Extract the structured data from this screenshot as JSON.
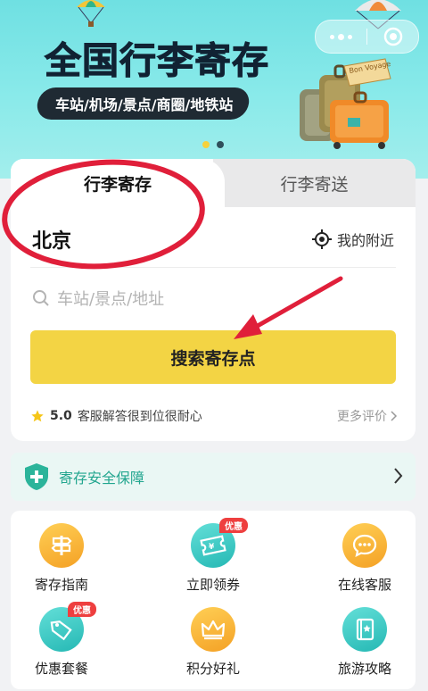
{
  "banner": {
    "title": "全国行李寄存",
    "subtitle": "车站/机场/景点/商圈/地铁站",
    "luggage_sticker": "Bon Voyage",
    "carousel_active_index": 0,
    "carousel_count": 2
  },
  "capsule": {
    "more_icon": "more-dots-icon",
    "close_icon": "close-target-icon"
  },
  "tabs": {
    "storage": "行李寄存",
    "delivery": "行李寄送"
  },
  "location": {
    "city": "北京",
    "nearby_label": "我的附近"
  },
  "search": {
    "placeholder": "车站/景点/地址",
    "button_label": "搜索寄存点"
  },
  "rating": {
    "score": "5.0",
    "comment": "客服解答很到位很耐心",
    "more_label": "更多评价"
  },
  "safety": {
    "label": "寄存安全保障"
  },
  "services": [
    {
      "label": "寄存指南",
      "icon": "signpost-icon",
      "color": "orange",
      "badge": ""
    },
    {
      "label": "立即领券",
      "icon": "coupon-icon",
      "color": "teal",
      "badge": "优惠"
    },
    {
      "label": "在线客服",
      "icon": "chat-icon",
      "color": "orange",
      "badge": ""
    },
    {
      "label": "优惠套餐",
      "icon": "tag-icon",
      "color": "teal",
      "badge": "优惠"
    },
    {
      "label": "积分好礼",
      "icon": "crown-icon",
      "color": "orange",
      "badge": ""
    },
    {
      "label": "旅游攻略",
      "icon": "guidebook-icon",
      "color": "teal",
      "badge": ""
    }
  ],
  "colors": {
    "accent_yellow": "#f3d444",
    "banner_teal": "#7fe6e6",
    "safety_green": "#23a68f",
    "badge_red": "#ee3f3f",
    "annotation_red": "#e01f3a"
  }
}
